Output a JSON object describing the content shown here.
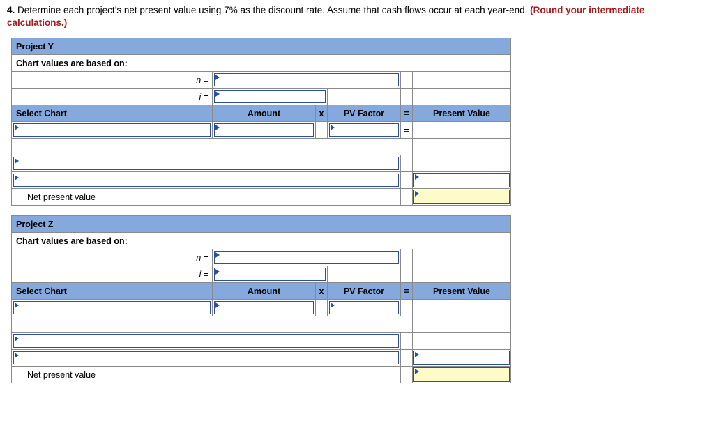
{
  "question": {
    "number": "4.",
    "text": " Determine each project’s net present value using 7% as the discount rate. Assume that cash flows occur at each year-end. ",
    "emphasis": "(Round your intermediate calculations.)"
  },
  "colors": {
    "header_blue": "#86a9dd",
    "input_border": "#2b4f9e",
    "answer_yellow": "#fdfbc8",
    "emphasis_red": "#a51c21"
  },
  "tables": [
    {
      "title": "Project Y",
      "basis_label": "Chart values are based on:",
      "n_label": "n =",
      "i_label": "i =",
      "n_value": "",
      "i_value": "",
      "columns": [
        "Select Chart",
        "Amount",
        "x",
        "PV Factor",
        "=",
        "Present Value"
      ],
      "entry_row": {
        "select_chart": "",
        "amount": "",
        "times": "x",
        "pv_factor": "",
        "equals": "=",
        "present_value": ""
      },
      "net_present_value_label": "Net present value",
      "net_present_value": ""
    },
    {
      "title": "Project Z",
      "basis_label": "Chart values are based on:",
      "n_label": "n =",
      "i_label": "i =",
      "n_value": "",
      "i_value": "",
      "columns": [
        "Select Chart",
        "Amount",
        "x",
        "PV Factor",
        "=",
        "Present Value"
      ],
      "entry_row": {
        "select_chart": "",
        "amount": "",
        "times": "x",
        "pv_factor": "",
        "equals": "=",
        "present_value": ""
      },
      "net_present_value_label": "Net present value",
      "net_present_value": ""
    }
  ]
}
